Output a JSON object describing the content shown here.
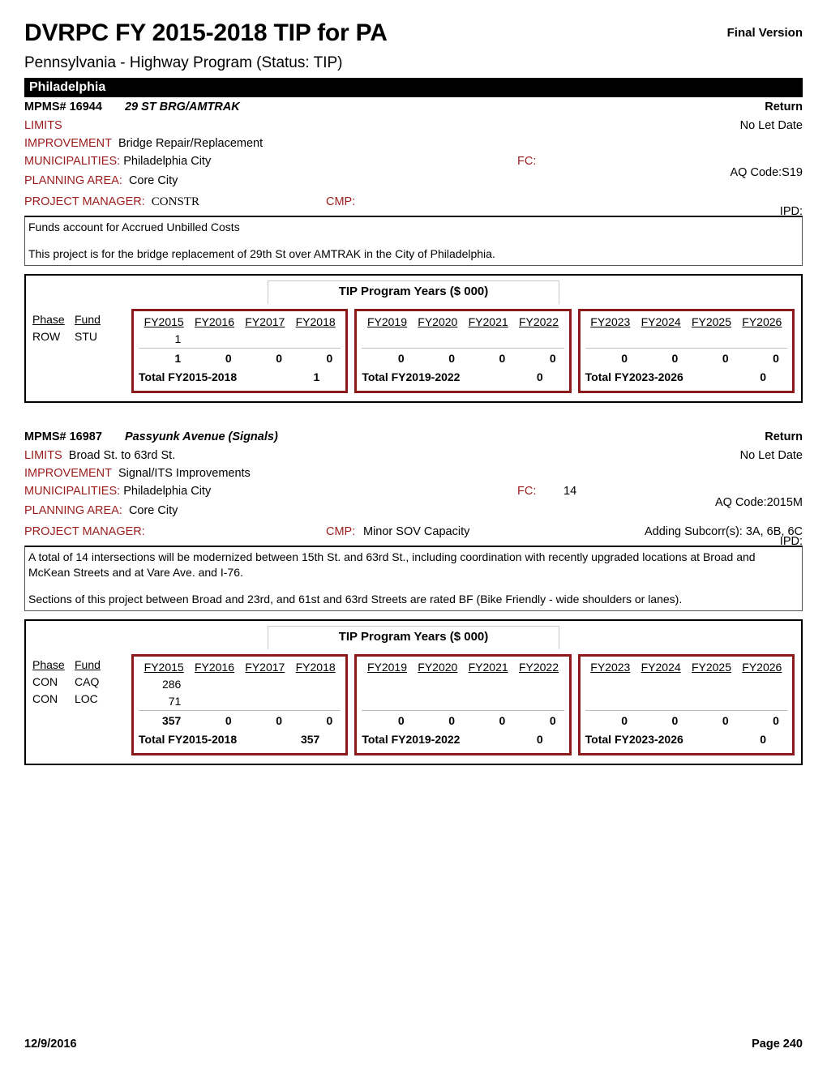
{
  "header": {
    "title": "DVRPC FY 2015-2018 TIP for PA",
    "version_badge": "Final Version",
    "subtitle": "Pennsylvania - Highway Program (Status: TIP)",
    "region": "Philadelphia"
  },
  "labels": {
    "mpms": "MPMS#",
    "limits": "LIMITS",
    "improvement": "IMPROVEMENT",
    "municipalities": "MUNICIPALITIES:",
    "planning_area": "PLANNING AREA:",
    "project_manager": "PROJECT MANAGER:",
    "fc": "FC:",
    "cmp": "CMP:",
    "return": "Return",
    "phase": "Phase",
    "fund": "Fund",
    "tip_title": "TIP Program Years ($ 000)"
  },
  "projects": [
    {
      "mpms_number": "16944",
      "name": "29 ST BRG/AMTRAK",
      "return_link": "Return",
      "limits": "",
      "let_date": "No Let Date",
      "improvement": "Bridge Repair/Replacement",
      "municipalities": "Philadelphia City",
      "fc": "",
      "aq_code": "AQ Code:S19",
      "planning_area": "Core City",
      "ipd": "IPD:",
      "project_manager": "CONSTR",
      "cmp": "",
      "subcorr": "",
      "description_lines": [
        "Funds account for Accrued Unbilled Costs",
        "",
        "This project is for the bridge replacement of 29th St over AMTRAK in the City of Philadelphia."
      ],
      "tip_title": "TIP Program Years ($ 000)",
      "funding_rows": [
        {
          "phase": "ROW",
          "fund": "STU",
          "values": [
            "1",
            "",
            "",
            ""
          ]
        }
      ],
      "panels": [
        {
          "years": [
            "FY2015",
            "FY2016",
            "FY2017",
            "FY2018"
          ],
          "rows": [
            [
              "1",
              "",
              "",
              ""
            ]
          ],
          "subtotals": [
            "1",
            "0",
            "0",
            "0"
          ],
          "total_label": "Total FY2015-2018",
          "total_value": "1"
        },
        {
          "years": [
            "FY2019",
            "FY2020",
            "FY2021",
            "FY2022"
          ],
          "rows": [
            [
              "",
              "",
              "",
              ""
            ]
          ],
          "subtotals": [
            "0",
            "0",
            "0",
            "0"
          ],
          "total_label": "Total FY2019-2022",
          "total_value": "0"
        },
        {
          "years": [
            "FY2023",
            "FY2024",
            "FY2025",
            "FY2026"
          ],
          "rows": [
            [
              "",
              "",
              "",
              ""
            ]
          ],
          "subtotals": [
            "0",
            "0",
            "0",
            "0"
          ],
          "total_label": "Total FY2023-2026",
          "total_value": "0"
        }
      ]
    },
    {
      "mpms_number": "16987",
      "name": "Passyunk Avenue (Signals)",
      "return_link": "Return",
      "limits": "Broad St. to 63rd St.",
      "let_date": "No Let Date",
      "improvement": "Signal/ITS Improvements",
      "municipalities": "Philadelphia City",
      "fc": "14",
      "aq_code": "AQ Code:2015M",
      "planning_area": "Core City",
      "ipd": "IPD:",
      "project_manager": "",
      "cmp": "Minor SOV Capacity",
      "subcorr": "Adding Subcorr(s): 3A, 6B, 6C",
      "description_lines": [
        "A total of 14 intersections will be modernized between 15th St. and 63rd St., including coordination with recently upgraded locations at Broad and McKean Streets and at Vare Ave. and I-76.",
        "",
        "Sections of this project between Broad and 23rd, and 61st and 63rd Streets are rated BF (Bike Friendly - wide shoulders or lanes)."
      ],
      "tip_title": "TIP Program Years ($ 000)",
      "funding_rows": [
        {
          "phase": "CON",
          "fund": "CAQ",
          "values": [
            "286",
            "",
            "",
            ""
          ]
        },
        {
          "phase": "CON",
          "fund": "LOC",
          "values": [
            "71",
            "",
            "",
            ""
          ]
        }
      ],
      "panels": [
        {
          "years": [
            "FY2015",
            "FY2016",
            "FY2017",
            "FY2018"
          ],
          "rows": [
            [
              "286",
              "",
              "",
              ""
            ],
            [
              "71",
              "",
              "",
              ""
            ]
          ],
          "subtotals": [
            "357",
            "0",
            "0",
            "0"
          ],
          "total_label": "Total FY2015-2018",
          "total_value": "357"
        },
        {
          "years": [
            "FY2019",
            "FY2020",
            "FY2021",
            "FY2022"
          ],
          "rows": [
            [
              "",
              "",
              "",
              ""
            ],
            [
              "",
              "",
              "",
              ""
            ]
          ],
          "subtotals": [
            "0",
            "0",
            "0",
            "0"
          ],
          "total_label": "Total FY2019-2022",
          "total_value": "0"
        },
        {
          "years": [
            "FY2023",
            "FY2024",
            "FY2025",
            "FY2026"
          ],
          "rows": [
            [
              "",
              "",
              "",
              ""
            ],
            [
              "",
              "",
              "",
              ""
            ]
          ],
          "subtotals": [
            "0",
            "0",
            "0",
            "0"
          ],
          "total_label": "Total FY2023-2026",
          "total_value": "0"
        }
      ]
    }
  ],
  "footer": {
    "date": "12/9/2016",
    "page": "Page 240"
  },
  "colors": {
    "label_red": "#9B1C1C",
    "panel_border": "#8B1A1A",
    "region_bar_bg": "#000000"
  }
}
